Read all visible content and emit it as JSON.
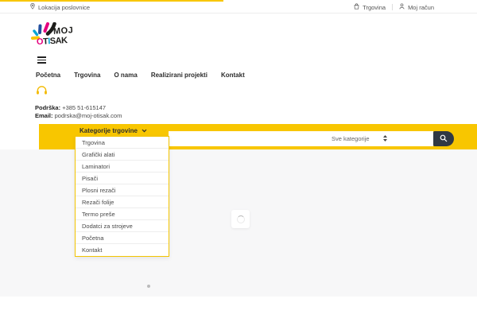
{
  "colors": {
    "accent_yellow": "#F8C600",
    "search_button_dark": "#303844",
    "logo_magenta": "#E5007E",
    "logo_blue": "#2350A0",
    "logo_cyan": "#00A5D6",
    "content_background": "#f7f7f8"
  },
  "topbar": {
    "location": "Lokacija poslovnice",
    "shop": "Trgovina",
    "account": "Moj račun"
  },
  "brand": {
    "line1": "MOJ",
    "line2_letters": [
      {
        "ch": "O",
        "color": "#E5007E"
      },
      {
        "ch": "T",
        "color": "#1D1D1B"
      },
      {
        "ch": "I",
        "color": "#00A5D6"
      },
      {
        "ch": "S",
        "color": "#1D1D1B"
      },
      {
        "ch": "A",
        "color": "#1D1D1B"
      },
      {
        "ch": "K",
        "color": "#1D1D1B"
      }
    ]
  },
  "nav": {
    "items": [
      "Početna",
      "Trgovina",
      "O nama",
      "Realizirani projekti",
      "Kontakt"
    ]
  },
  "support": {
    "phone_label": "Podrška:",
    "phone": "+385 51-615147",
    "email_label": "Email:",
    "email": "podrska@moj-otisak.com"
  },
  "category_bar": {
    "label": "Kategorije trgovine",
    "select_label": "Sve kategorije"
  },
  "dropdown": {
    "items": [
      "Trgovina",
      "Grafički alati",
      "Laminatori",
      "Pisači",
      "Plosni rezači",
      "Rezači folije",
      "Termo preše",
      "Dodatci za strojeve",
      "Početna",
      "Kontakt"
    ]
  }
}
